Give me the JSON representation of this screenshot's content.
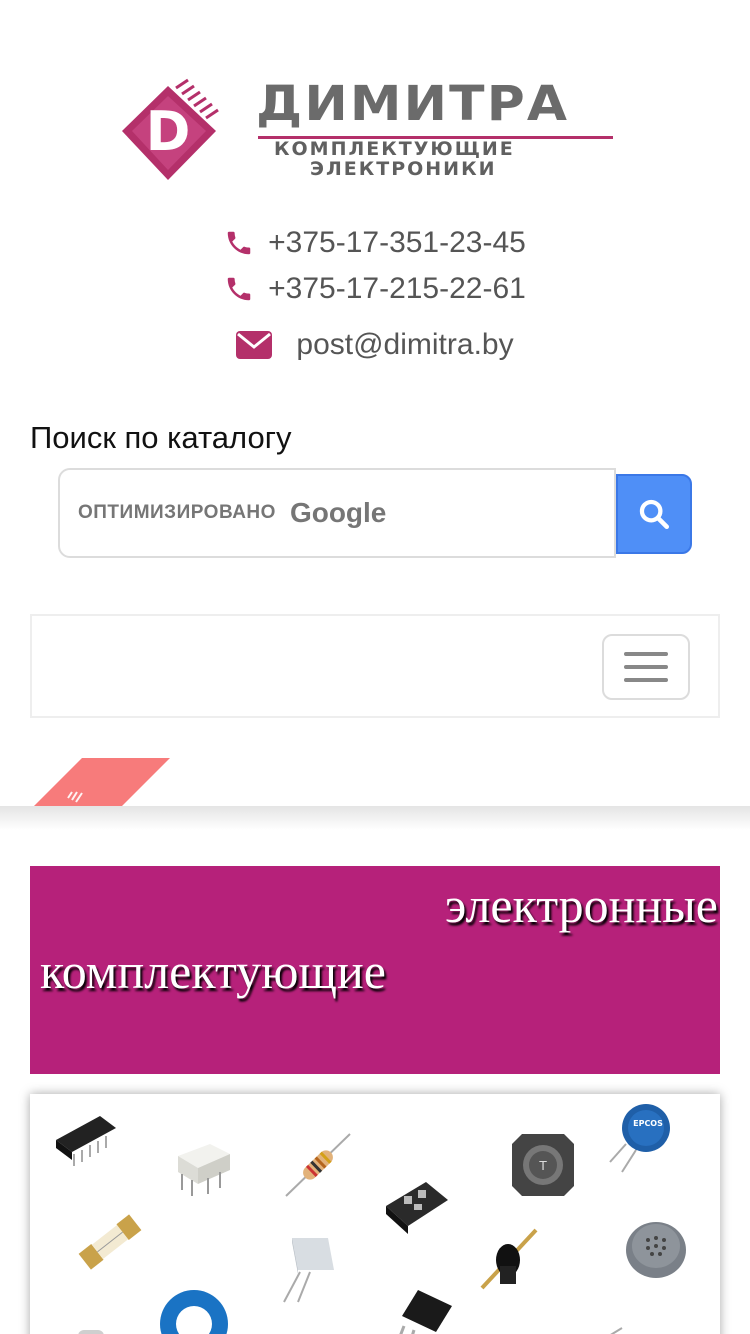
{
  "header": {
    "logo": {
      "brand": "ДИМИТРА",
      "subtitle_line1": "КОМПЛЕКТУЮЩИЕ",
      "subtitle_line2": "ЭЛЕКТРОНИКИ",
      "chip_letter": "D"
    },
    "phones": [
      "+375-17-351-23-45",
      "+375-17-215-22-61"
    ],
    "email": "post@dimitra.by",
    "icons": {
      "phone": "phone-icon",
      "email": "envelope-icon"
    }
  },
  "search": {
    "label": "Поиск по каталогу",
    "powered_by": "ОПТИМИЗИРОВАНО",
    "provider": "Google",
    "button_icon": "search-icon"
  },
  "nav": {
    "toggler_icon": "hamburger-icon"
  },
  "banner": {
    "line1": "электронные",
    "line2": "комплектующие"
  },
  "colors": {
    "accent": "#b6217a",
    "icon": "#b4306a",
    "search_button": "#4f8ff7",
    "ribbon": "#f77b7b"
  }
}
